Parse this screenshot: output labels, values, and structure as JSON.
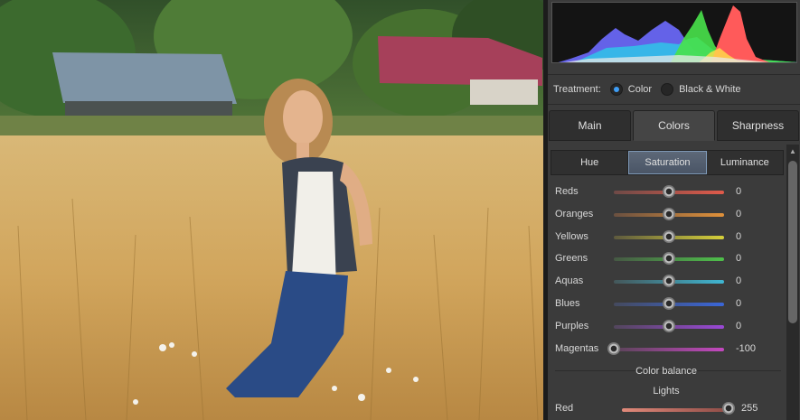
{
  "photo": {
    "description_icon": "field-photo"
  },
  "treatment": {
    "label": "Treatment:",
    "options": [
      {
        "label": "Color",
        "selected": true
      },
      {
        "label": "Black & White",
        "selected": false
      }
    ]
  },
  "tabs": [
    {
      "label": "Main",
      "active": false
    },
    {
      "label": "Colors",
      "active": true
    },
    {
      "label": "Sharpness",
      "active": false
    }
  ],
  "subtabs": [
    {
      "label": "Hue",
      "active": false
    },
    {
      "label": "Saturation",
      "active": true
    },
    {
      "label": "Luminance",
      "active": false
    }
  ],
  "sliders": [
    {
      "label": "Reds",
      "value": "0",
      "fraction": 0.5,
      "color_a": "#6e4a47",
      "color_b": "#e05a4a"
    },
    {
      "label": "Oranges",
      "value": "0",
      "fraction": 0.5,
      "color_a": "#6a5040",
      "color_b": "#e0913a"
    },
    {
      "label": "Yellows",
      "value": "0",
      "fraction": 0.5,
      "color_a": "#5e5a3e",
      "color_b": "#d6d03a"
    },
    {
      "label": "Greens",
      "value": "0",
      "fraction": 0.5,
      "color_a": "#465844",
      "color_b": "#4ec04a"
    },
    {
      "label": "Aquas",
      "value": "0",
      "fraction": 0.5,
      "color_a": "#44575a",
      "color_b": "#3fb6d2"
    },
    {
      "label": "Blues",
      "value": "0",
      "fraction": 0.5,
      "color_a": "#454a5e",
      "color_b": "#3a66d8"
    },
    {
      "label": "Purples",
      "value": "0",
      "fraction": 0.5,
      "color_a": "#52465c",
      "color_b": "#9a48d6"
    },
    {
      "label": "Magentas",
      "value": "-100",
      "fraction": 0.0,
      "color_a": "#5a4458",
      "color_b": "#c448c0"
    }
  ],
  "color_balance": {
    "title": "Color balance",
    "section": "Lights",
    "red": {
      "label": "Red",
      "value": "255",
      "fraction": 1.0
    }
  }
}
